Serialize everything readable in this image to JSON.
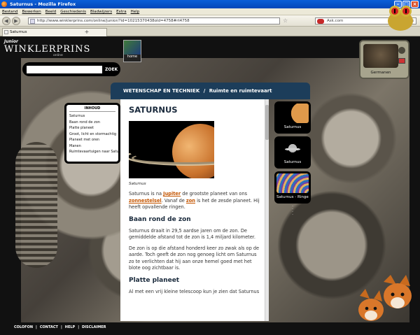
{
  "window": {
    "title": "Saturnus - Mozilla Firefox"
  },
  "menu": [
    "Bestand",
    "Bewerken",
    "Beeld",
    "Geschiedenis",
    "Bladwijzers",
    "Extra",
    "Help"
  ],
  "browser": {
    "url": "http://www.winklerprins.com/online/junior/?id=10215370438old=4758#rt4758",
    "search_value": "Ask.com",
    "tab_label": "Saturnus"
  },
  "site": {
    "logo_junior": "Junior",
    "logo_main": "WINKLERPRINS",
    "logo_online": "online",
    "home_label": "home",
    "search_button": "ZOEK",
    "search_value": "",
    "tv_caption": "Germanen"
  },
  "section": {
    "category": "WETENSCHAP EN TECHNIEK",
    "separator": "/",
    "subcategory": "Ruimte en ruimtevaart"
  },
  "article": {
    "title": "SATURNUS",
    "image_caption": "Saturnus",
    "p1_a": "Saturnus is na ",
    "p1_link1": "Jupiter",
    "p1_b": " de grootste planeet van ons ",
    "p1_link2": "zonnestelsel",
    "p1_c": ". Vanaf de ",
    "p1_link3": "zon",
    "p1_d": " is het de zesde planeet. Hij heeft opvallende ringen.",
    "h1": "Baan rond de zon",
    "p2": "Saturnus draait in 29,5 aardse jaren om de zon. De gemiddelde afstand tot de zon is 1,4 miljard kilometer.",
    "p3": "De zon is op die afstand honderd keer zo zwak als op de aarde. Toch geeft de zon nog genoeg licht om Saturnus zo te verlichten dat hij aan onze hemel goed met het blote oog zichtbaar is.",
    "h2": "Platte planeet",
    "p4": "Al met een vrij kleine telescoop kun je zien dat Saturnus"
  },
  "inhoud": {
    "heading": "INHOUD",
    "items": [
      "Saturnus",
      "Baan rond de zon",
      "Platte planeet",
      "Groot, licht en stormachtig",
      "Planeet met oren",
      "Manen",
      "Ruimtevaartuigen naar Saturnus"
    ]
  },
  "thumbnails": [
    {
      "label": "Saturnus"
    },
    {
      "label": "Saturnus"
    },
    {
      "label": "Saturnus - Ringen"
    }
  ],
  "footer": [
    "COLOFON",
    "|",
    "CONTACT",
    "|",
    "HELP",
    "|",
    "DISCLAIMER"
  ]
}
